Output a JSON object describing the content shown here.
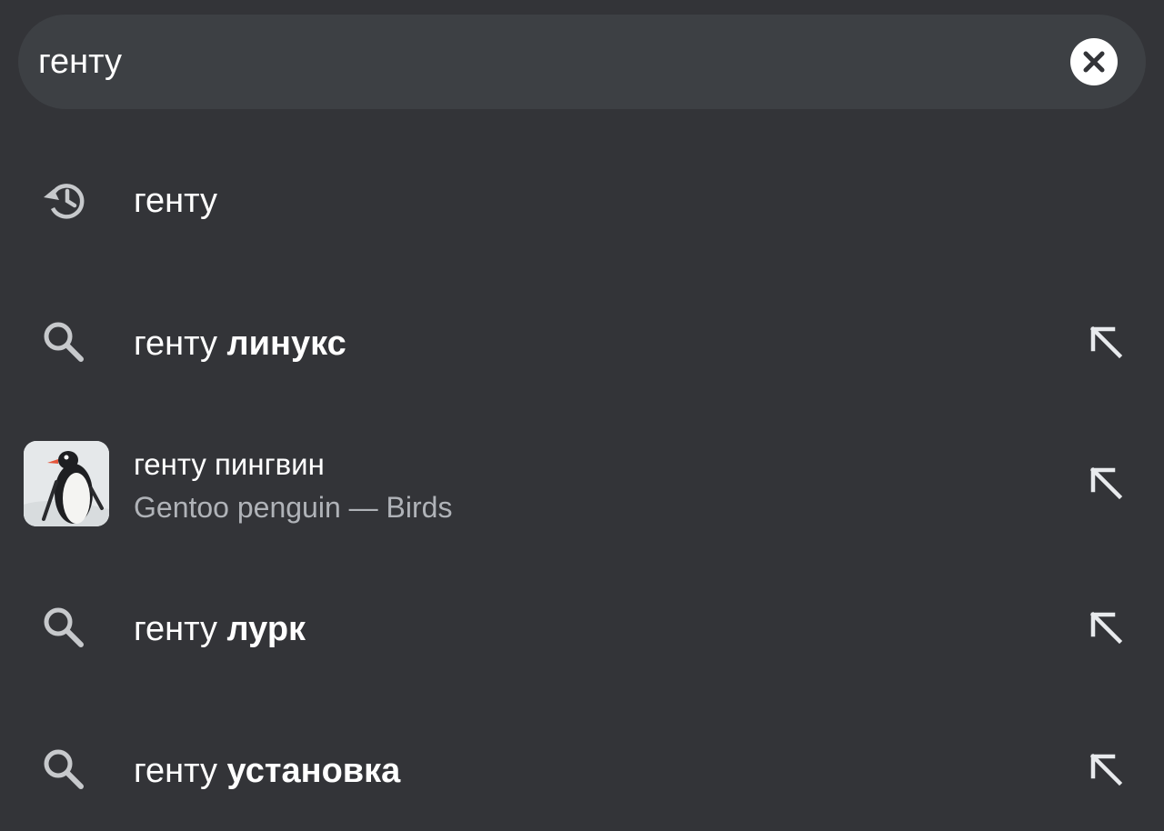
{
  "search": {
    "query": "генту",
    "clear_icon": "close-circle-icon"
  },
  "suggestions": [
    {
      "type": "history",
      "icon": "history-icon",
      "prefix": "генту",
      "suffix": ""
    },
    {
      "type": "search",
      "icon": "search-icon",
      "prefix": "генту ",
      "suffix": "линукс",
      "action_icon": "arrow-up-left-icon"
    },
    {
      "type": "entity",
      "icon": "penguin-thumbnail",
      "title": "генту пингвин",
      "subtitle": "Gentoo penguin — Birds",
      "action_icon": "arrow-up-left-icon"
    },
    {
      "type": "search",
      "icon": "search-icon",
      "prefix": "генту ",
      "suffix": "лурк",
      "action_icon": "arrow-up-left-icon"
    },
    {
      "type": "search",
      "icon": "search-icon",
      "prefix": "генту ",
      "suffix": "установка",
      "action_icon": "arrow-up-left-icon"
    }
  ],
  "colors": {
    "background": "#333438",
    "search_bar": "#3d4044",
    "text": "#ffffff",
    "secondary_text": "#b0b3b8",
    "icon": "#c7c9cc"
  }
}
